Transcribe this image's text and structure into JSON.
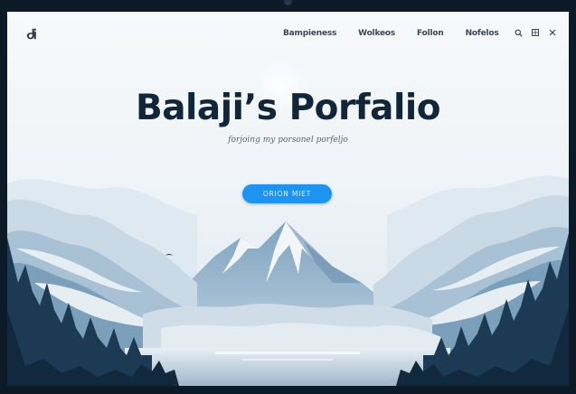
{
  "site": {
    "logo_text": "ᏧᎥ"
  },
  "nav": {
    "links": [
      {
        "label": "Bampieness"
      },
      {
        "label": "Wolkeos"
      },
      {
        "label": "Follon"
      },
      {
        "label": "Nofelos"
      }
    ],
    "icons": [
      "search-icon",
      "grid-icon",
      "close-icon"
    ]
  },
  "hero": {
    "title": "Balaji’s Porfalio",
    "subtitle": "forjoing my porsonel porfeljo",
    "cta_label": "ORION MIET"
  },
  "colors": {
    "accent": "#1f93f0",
    "title": "#12263a",
    "frame": "#0c1a28"
  }
}
